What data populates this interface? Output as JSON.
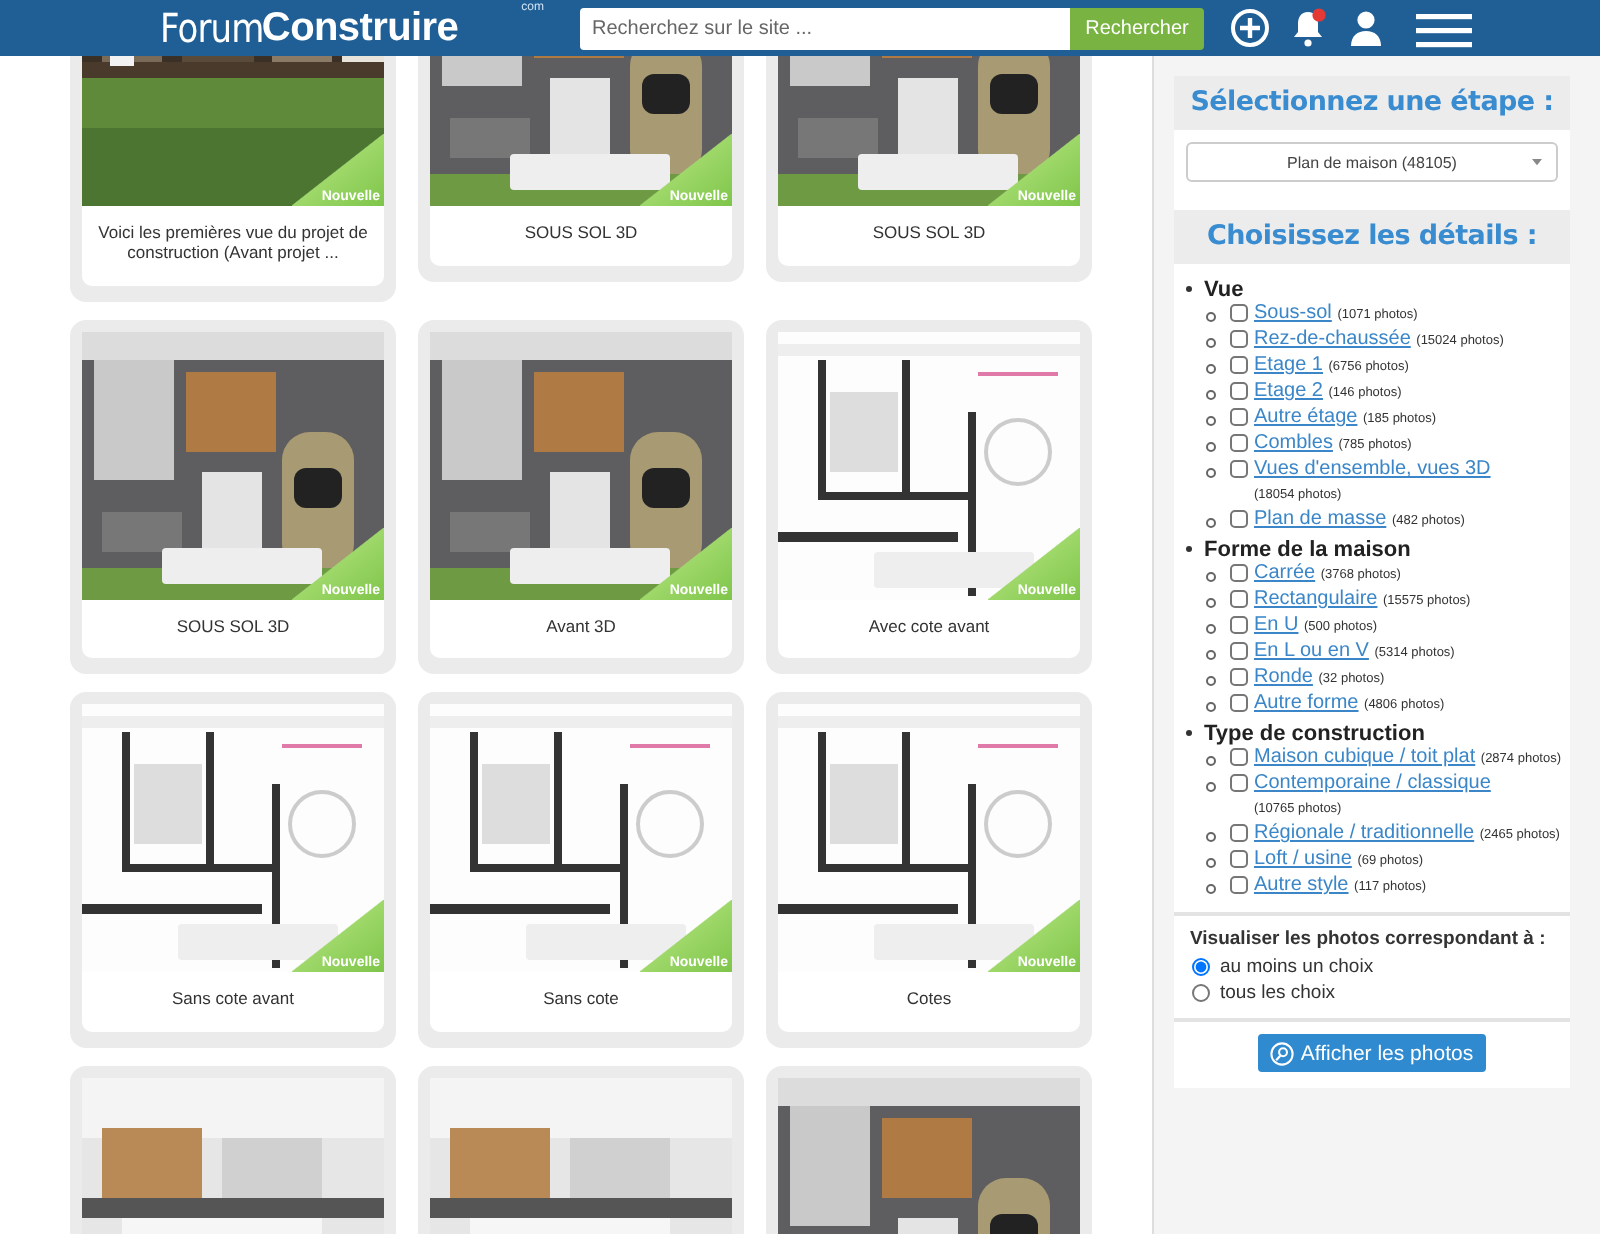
{
  "header": {
    "logo": {
      "light": "Forum",
      "bold": "Construire",
      "tld": "com"
    },
    "search": {
      "placeholder": "Recherchez sur le site ...",
      "button": "Rechercher"
    },
    "notification_dot": true
  },
  "gallery": [
    {
      "caption": "Voici les premières vue du projet de construction (Avant projet ...",
      "kind": "picture",
      "badge": "Nouvelle"
    },
    {
      "caption": "SOUS SOL 3D",
      "kind": "picture",
      "badge": "Nouvelle"
    },
    {
      "caption": "SOUS SOL 3D",
      "kind": "picture",
      "badge": "Nouvelle"
    },
    {
      "caption": "SOUS SOL 3D",
      "kind": "picture",
      "badge": "Nouvelle"
    },
    {
      "caption": "Avant 3D",
      "kind": "picture",
      "badge": "Nouvelle"
    },
    {
      "caption": "Avec cote avant",
      "kind": "picture",
      "badge": "Nouvelle"
    },
    {
      "caption": "Sans cote avant",
      "kind": "picture",
      "badge": "Nouvelle"
    },
    {
      "caption": "Sans cote",
      "kind": "picture",
      "badge": "Nouvelle"
    },
    {
      "caption": "Cotes",
      "kind": "picture",
      "badge": "Nouvelle"
    },
    {
      "kind": "picture"
    },
    {
      "kind": "picture"
    },
    {
      "kind": "picture"
    }
  ],
  "panel": {
    "step_title": "Sélectionnez une étape :",
    "step_select": "Plan de maison (48105)",
    "details_title": "Choisissez les détails :",
    "groups": [
      {
        "label": "Vue",
        "options": [
          {
            "label": "Sous-sol",
            "count": "(1071 photos)",
            "checked": false
          },
          {
            "label": "Rez-de-chaussée",
            "count": "(15024 photos)",
            "checked": false
          },
          {
            "label": "Etage 1",
            "count": "(6756 photos)",
            "checked": false
          },
          {
            "label": "Etage 2",
            "count": "(146 photos)",
            "checked": false
          },
          {
            "label": "Autre étage",
            "count": "(185 photos)",
            "checked": false
          },
          {
            "label": "Combles",
            "count": "(785 photos)",
            "checked": false
          },
          {
            "label": "Vues d'ensemble, vues 3D",
            "count": "(18054 photos)",
            "checked": false
          },
          {
            "label": "Plan de masse",
            "count": "(482 photos)",
            "checked": false
          }
        ]
      },
      {
        "label": "Forme de la maison",
        "options": [
          {
            "label": "Carrée",
            "count": "(3768 photos)",
            "checked": false
          },
          {
            "label": "Rectangulaire",
            "count": "(15575 photos)",
            "checked": false
          },
          {
            "label": "En U",
            "count": "(500 photos)",
            "checked": false
          },
          {
            "label": "En L ou en V",
            "count": "(5314 photos)",
            "checked": false
          },
          {
            "label": "Ronde",
            "count": "(32 photos)",
            "checked": false
          },
          {
            "label": "Autre forme",
            "count": "(4806 photos)",
            "checked": false
          }
        ]
      },
      {
        "label": "Type de construction",
        "options": [
          {
            "label": "Maison cubique / toit plat",
            "count": "(2874 photos)",
            "checked": false
          },
          {
            "label": "Contemporaine / classique",
            "count": "(10765 photos)",
            "checked": false
          },
          {
            "label": "Régionale / traditionnelle",
            "count": "(2465 photos)",
            "checked": false
          },
          {
            "label": "Loft / usine",
            "count": "(69 photos)",
            "checked": false
          },
          {
            "label": "Autre style",
            "count": "(117 photos)",
            "checked": false
          }
        ]
      }
    ],
    "match_title": "Visualiser les photos correspondant à :",
    "match_options": [
      {
        "label": "au moins un choix",
        "selected": true
      },
      {
        "label": "tous les choix",
        "selected": false
      }
    ],
    "submit": "Afficher les photos"
  }
}
